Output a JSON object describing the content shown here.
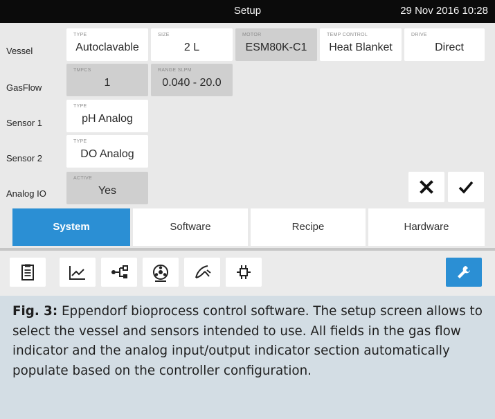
{
  "titlebar": {
    "title": "Setup",
    "datetime": "29 Nov 2016  10:28"
  },
  "rows": {
    "vessel": {
      "label": "Vessel",
      "type": {
        "caption": "TYPE",
        "value": "Autoclavable"
      },
      "size": {
        "caption": "SIZE",
        "value": "2 L"
      },
      "motor": {
        "caption": "MOTOR",
        "value": "ESM80K-C1"
      },
      "temp": {
        "caption": "TEMP CONTROL",
        "value": "Heat Blanket"
      },
      "drive": {
        "caption": "DRIVE",
        "value": "Direct"
      }
    },
    "gasflow": {
      "label": "GasFlow",
      "tmfcs": {
        "caption": "TMFCS",
        "value": "1"
      },
      "range": {
        "caption": "RANGE  SLPM",
        "value": "0.040 - 20.0"
      }
    },
    "sensor1": {
      "label": "Sensor 1",
      "type": {
        "caption": "TYPE",
        "value": "pH Analog"
      }
    },
    "sensor2": {
      "label": "Sensor 2",
      "type": {
        "caption": "TYPE",
        "value": "DO Analog"
      }
    },
    "analogio": {
      "label": "Analog IO",
      "active": {
        "caption": "ACTIVE",
        "value": "Yes"
      }
    }
  },
  "tabs": [
    "System",
    "Software",
    "Recipe",
    "Hardware"
  ],
  "toolbar_icons": [
    "clipboard-icon",
    "trend-chart-icon",
    "connection-icon",
    "pump-icon",
    "probe-icon",
    "io-module-icon",
    "wrench-icon"
  ],
  "caption": {
    "fig": "Fig. 3:",
    "text": "Eppendorf bioprocess control software. The setup screen allows to select the vessel and sensors intended to use. All fields in the gas flow indicator and the analog input/output indicator section automatically populate based on the controller configuration."
  },
  "colors": {
    "accent": "#2b8fd4",
    "titlebar": "#0b0b0b",
    "caption_bg": "#d3dde4",
    "readonly_field": "#cfcfcf"
  }
}
